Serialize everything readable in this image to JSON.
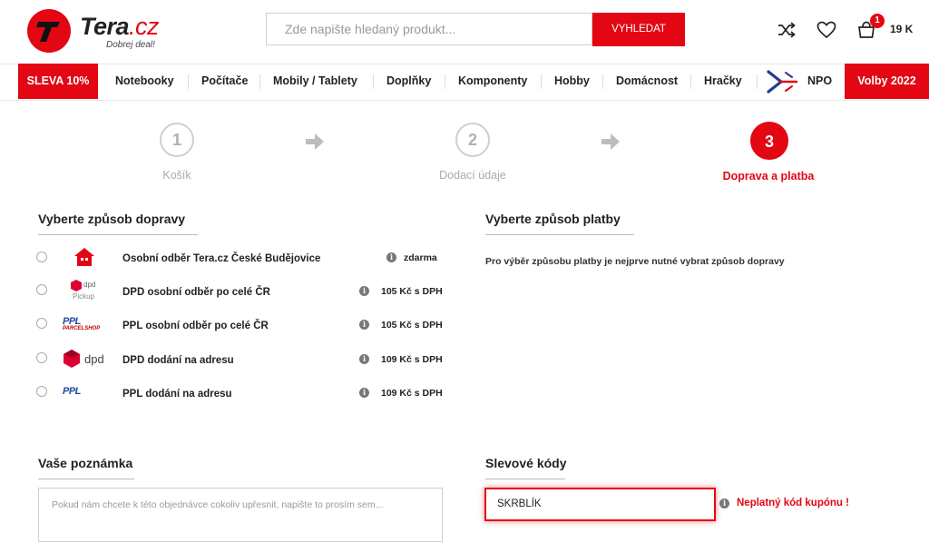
{
  "header": {
    "logo_letter": "T",
    "logo_name": "Tera",
    "logo_domain": ".cz",
    "tagline": "Dobrej deal!",
    "search_placeholder": "Zde napište hledaný produkt...",
    "search_button": "VYHLEDAT",
    "cart_count": "1",
    "cart_total": "19 K",
    "icons": [
      "shuffle-icon",
      "heart-icon",
      "cart-icon"
    ]
  },
  "nav": {
    "promo": "SLEVA 10%",
    "items": [
      "Notebooky",
      "Počítače",
      "Mobily / Tablety",
      "Doplňky",
      "Komponenty",
      "Hobby",
      "Domácnost",
      "Hračky"
    ],
    "npo": "NPO",
    "election": "Volby 2022"
  },
  "steps": [
    {
      "number": "1",
      "label": "Košík"
    },
    {
      "number": "2",
      "label": "Dodací údaje"
    },
    {
      "number": "3",
      "label": "Doprava a platba"
    }
  ],
  "shipping": {
    "title": "Vyberte způsob dopravy",
    "options": [
      {
        "name": "Osobní odběr Tera.cz České Budějovice",
        "price": "zdarma",
        "icon": "house-icon"
      },
      {
        "name": "DPD osobní odběr po celé ČR",
        "price": "105 Kč s DPH",
        "icon": "dpd-pickup-logo",
        "logo_text": "dpd",
        "logo_sub": "Pickup"
      },
      {
        "name": "PPL osobní odběr po celé ČR",
        "price": "105 Kč s DPH",
        "icon": "ppl-parcelshop-logo",
        "logo_text": "PPL",
        "logo_sub": "PARCELSHOP"
      },
      {
        "name": "DPD dodání na adresu",
        "price": "109 Kč s DPH",
        "icon": "dpd-logo",
        "logo_text": "dpd"
      },
      {
        "name": "PPL dodání na adresu",
        "price": "109 Kč s DPH",
        "icon": "ppl-logo",
        "logo_text": "PPL"
      }
    ]
  },
  "payment": {
    "title": "Vyberte způsob platby",
    "note": "Pro výběr způsobu platby je nejprve nutné vybrat způsob dopravy"
  },
  "note": {
    "title": "Vaše poznámka",
    "placeholder": "Pokud nám chcete k této objednávce cokoliv upřesnit, napište to prosím sem..."
  },
  "discount": {
    "title": "Slevové kódy",
    "value": "SKRBLÍK",
    "error": "Neplatný kód kupónu !"
  },
  "colors": {
    "brand_red": "#e30613",
    "npo_blue": "#2a3a8c"
  }
}
